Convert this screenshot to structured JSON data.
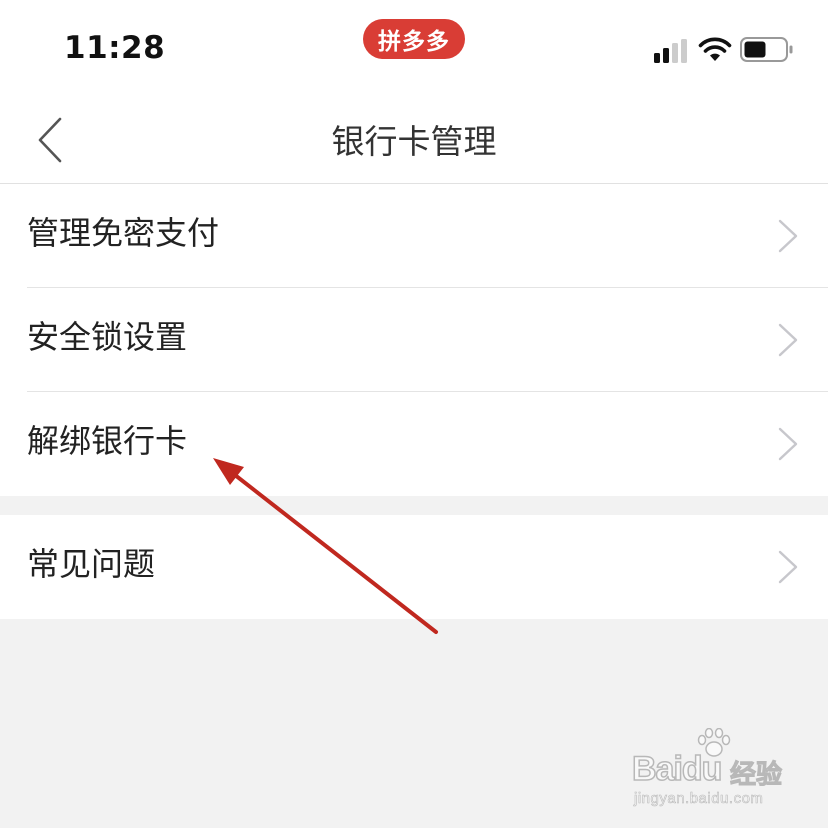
{
  "status_bar": {
    "time": "11:28",
    "app_badge": "拼多多",
    "icons": [
      "cellular-signal-icon",
      "wifi-icon",
      "battery-icon"
    ]
  },
  "nav": {
    "back_icon": "chevron-left-icon",
    "title": "银行卡管理"
  },
  "menu": {
    "group1": [
      {
        "label": "管理免密支付"
      },
      {
        "label": "安全锁设置"
      },
      {
        "label": "解绑银行卡"
      }
    ],
    "group2": [
      {
        "label": "常见问题"
      }
    ],
    "row_icon": "chevron-right-icon"
  },
  "annotation": {
    "color": "#c0281f",
    "points_to": "解绑银行卡"
  },
  "watermark": {
    "brand": "Baidu",
    "suffix": "经验",
    "url": "jingyan.baidu.com"
  },
  "colors": {
    "accent": "#d93d35",
    "background": "#f2f2f2",
    "surface": "#ffffff",
    "text": "#222222",
    "chevron": "#c7c7cc"
  }
}
